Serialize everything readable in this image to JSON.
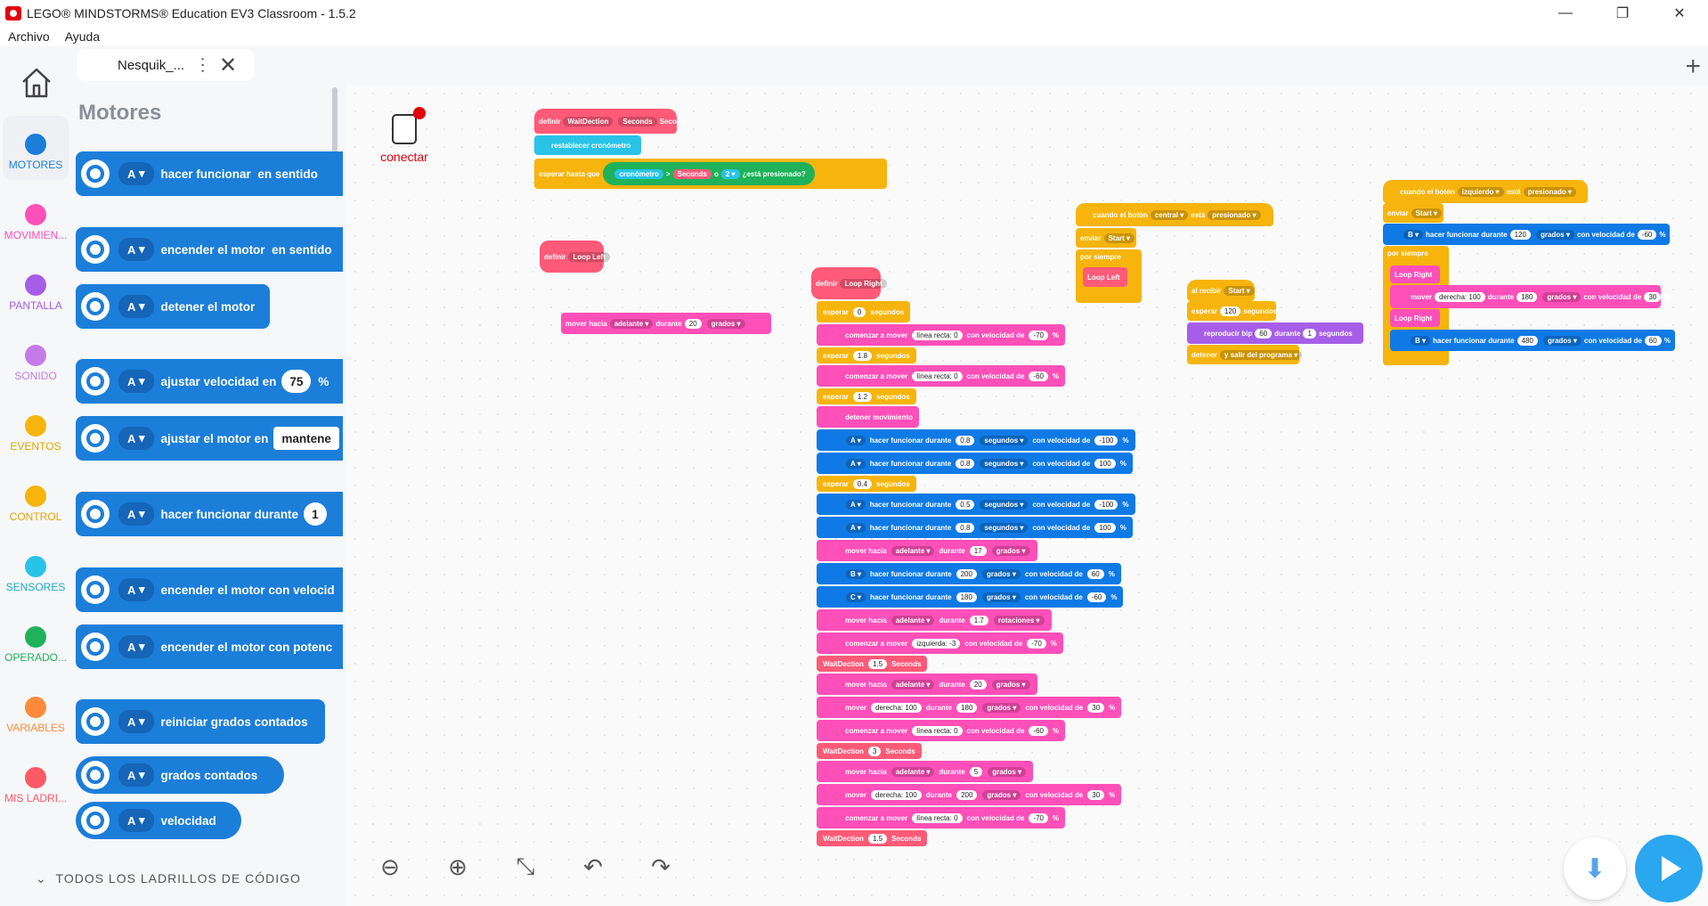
{
  "window": {
    "title": "LEGO® MINDSTORMS® Education EV3 Classroom - 1.5.2"
  },
  "menu": [
    "Archivo",
    "Ayuda"
  ],
  "tab": {
    "label": "Nesquik_..."
  },
  "categories": [
    {
      "label": "MOTORES",
      "color": "#1b7ed9"
    },
    {
      "label": "MOVIMIEN...",
      "color": "#ff4fb8"
    },
    {
      "label": "PANTALLA",
      "color": "#a65ee8"
    },
    {
      "label": "SONIDO",
      "color": "#c47be8"
    },
    {
      "label": "EVENTOS",
      "color": "#f6b40c"
    },
    {
      "label": "CONTROL",
      "color": "#f6b40c"
    },
    {
      "label": "SENSORES",
      "color": "#29c3e8"
    },
    {
      "label": "OPERADO...",
      "color": "#1fb25a"
    },
    {
      "label": "VARIABLES",
      "color": "#ff8a3c"
    },
    {
      "label": "MIS LADRI...",
      "color": "#ff5a66"
    }
  ],
  "palette": {
    "title": "Motores",
    "blocks": [
      {
        "port": "A",
        "text": "hacer funcionar",
        "extra": "en sentido"
      },
      {
        "port": "A",
        "text": "encender el motor",
        "extra": "en sentido"
      },
      {
        "port": "A",
        "text": "detener el motor",
        "extra": ""
      },
      {
        "port": "A",
        "text": "ajustar velocidad en",
        "value": "75",
        "suffix": "%"
      },
      {
        "port": "A",
        "text": "ajustar el motor en",
        "value": "mantene"
      },
      {
        "port": "A",
        "text": "hacer funcionar durante",
        "value": "1"
      },
      {
        "port": "A",
        "text": "encender el motor con velocid"
      },
      {
        "port": "A",
        "text": "encender el motor con potenc"
      },
      {
        "port": "A",
        "text": "reiniciar grados contados"
      },
      {
        "port": "A",
        "text": "grados contados"
      },
      {
        "port": "A",
        "text": "velocidad"
      }
    ],
    "footer": "TODOS LOS LADRILLOS DE CÓDIGO"
  },
  "connect": {
    "label": "conectar"
  },
  "scripts": {
    "def_wait": [
      "definir",
      "WaitDection",
      "Seconds",
      "Seconds"
    ],
    "reset_timer": "restablecer cronómetro",
    "wait_until": [
      "esperar hasta que",
      "cronómetro",
      ">",
      "Seconds",
      "o",
      "2 ▾",
      "¿está presionado?"
    ],
    "def_loop_left": [
      "definir",
      "Loop Left"
    ],
    "move_left": [
      "mover hacia",
      "adelante ▾",
      "durante",
      "20",
      "grados ▾"
    ],
    "central": [
      "cuando el botón",
      "central ▾",
      "está",
      "presionado ▾"
    ],
    "send_start": [
      "enviar",
      "Start ▾"
    ],
    "forever": "por siempre",
    "loop_left": "Loop Left",
    "recv": [
      "al recibir",
      "Start ▾"
    ],
    "wait120": [
      "esperar",
      "120",
      "segundos"
    ],
    "beep": [
      "reproducir bip",
      "60",
      "durante",
      "1",
      "segundos"
    ],
    "stop": [
      "detener",
      "y salir del programa ▾"
    ],
    "left_btn": [
      "cuando el botón",
      "izquierdo ▾",
      "está",
      "presionado ▾"
    ],
    "motorB": [
      "B ▾",
      "hacer funcionar durante",
      "120",
      "grados ▾",
      "con velocidad de",
      "-60",
      "%"
    ],
    "loop_right": "Loop Right",
    "move_r": [
      "mover",
      "derecha: 100",
      "durante",
      "180",
      "grados ▾",
      "con velocidad de",
      "30",
      "%"
    ],
    "motorB2": [
      "B ▾",
      "hacer funcionar durante",
      "480",
      "grados ▾",
      "con velocidad de",
      "60",
      "%"
    ],
    "def_loop_right": [
      "definir",
      "Loop Right"
    ],
    "main": [
      [
        "yel",
        "esperar|0|segundos"
      ],
      [
        "pink",
        "comenzar a mover|línea recta: 0|con velocidad de|-70|%"
      ],
      [
        "yel",
        "esperar|1.8|segundos"
      ],
      [
        "pink",
        "comenzar a mover|línea recta: 0|con velocidad de|-60|%"
      ],
      [
        "yel",
        "esperar|1.2|segundos"
      ],
      [
        "pink",
        "detener movimiento"
      ],
      [
        "blu",
        "A ▾|hacer funcionar durante|0.8|segundos ▾|con velocidad de|-100|%"
      ],
      [
        "blu",
        "A ▾|hacer funcionar durante|0.8|segundos ▾|con velocidad de|100|%"
      ],
      [
        "yel",
        "esperar|0.4|segundos"
      ],
      [
        "blu",
        "A ▾|hacer funcionar durante|0.5|segundos ▾|con velocidad de|-100|%"
      ],
      [
        "blu",
        "A ▾|hacer funcionar durante|0.8|segundos ▾|con velocidad de|100|%"
      ],
      [
        "pink",
        "mover hacia|adelante ▾|durante|17|grados ▾"
      ],
      [
        "blu",
        "B ▾|hacer funcionar durante|200|grados ▾|con velocidad de|60|%"
      ],
      [
        "blu",
        "C ▾|hacer funcionar durante|180|grados ▾|con velocidad de|-60|%"
      ],
      [
        "pink",
        "mover hacia|adelante ▾|durante|1.7|rotaciones ▾"
      ],
      [
        "pink",
        "comenzar a mover|izquierda: -3|con velocidad de|-70|%"
      ],
      [
        "red",
        "WaitDection|1.5|Seconds"
      ],
      [
        "pink",
        "mover hacia|adelante ▾|durante|20|grados ▾"
      ],
      [
        "pink",
        "mover|derecha: 100|durante|180|grados ▾|con velocidad de|30|%"
      ],
      [
        "pink",
        "comenzar a mover|línea recta: 0|con velocidad de|-60|%"
      ],
      [
        "red",
        "WaitDection|3|Seconds"
      ],
      [
        "pink",
        "mover hacia|adelante ▾|durante|5|grados ▾"
      ],
      [
        "pink",
        "mover|derecha: 100|durante|200|grados ▾|con velocidad de|30|%"
      ],
      [
        "pink",
        "comenzar a mover|línea recta: 0|con velocidad de|-70|%"
      ],
      [
        "red",
        "WaitDection|1.5|Seconds"
      ]
    ]
  }
}
